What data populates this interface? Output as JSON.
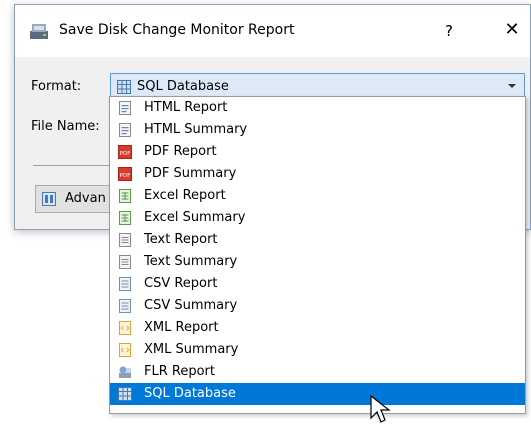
{
  "dialog": {
    "title": "Save Disk Change Monitor Report",
    "help_label": "?",
    "close_label": "✕",
    "format_label": "Format:",
    "filename_label": "File Name:",
    "format_value": "SQL Database",
    "advanced_label": "Advan"
  },
  "dropdown": {
    "options": [
      {
        "label": "HTML Report",
        "icon": "html-icon"
      },
      {
        "label": "HTML Summary",
        "icon": "html-icon"
      },
      {
        "label": "PDF Report",
        "icon": "pdf-icon"
      },
      {
        "label": "PDF Summary",
        "icon": "pdf-icon"
      },
      {
        "label": "Excel Report",
        "icon": "excel-icon"
      },
      {
        "label": "Excel Summary",
        "icon": "excel-icon"
      },
      {
        "label": "Text Report",
        "icon": "text-icon"
      },
      {
        "label": "Text Summary",
        "icon": "text-icon"
      },
      {
        "label": "CSV Report",
        "icon": "csv-icon"
      },
      {
        "label": "CSV Summary",
        "icon": "csv-icon"
      },
      {
        "label": "XML Report",
        "icon": "xml-icon"
      },
      {
        "label": "XML Summary",
        "icon": "xml-icon"
      },
      {
        "label": "FLR Report",
        "icon": "flr-icon"
      },
      {
        "label": "SQL Database",
        "icon": "sql-icon",
        "selected": true
      }
    ]
  },
  "colors": {
    "selection": "#0078d7",
    "combo_bg": "#dde9f7",
    "dialog_bg": "#f0f0f0"
  }
}
